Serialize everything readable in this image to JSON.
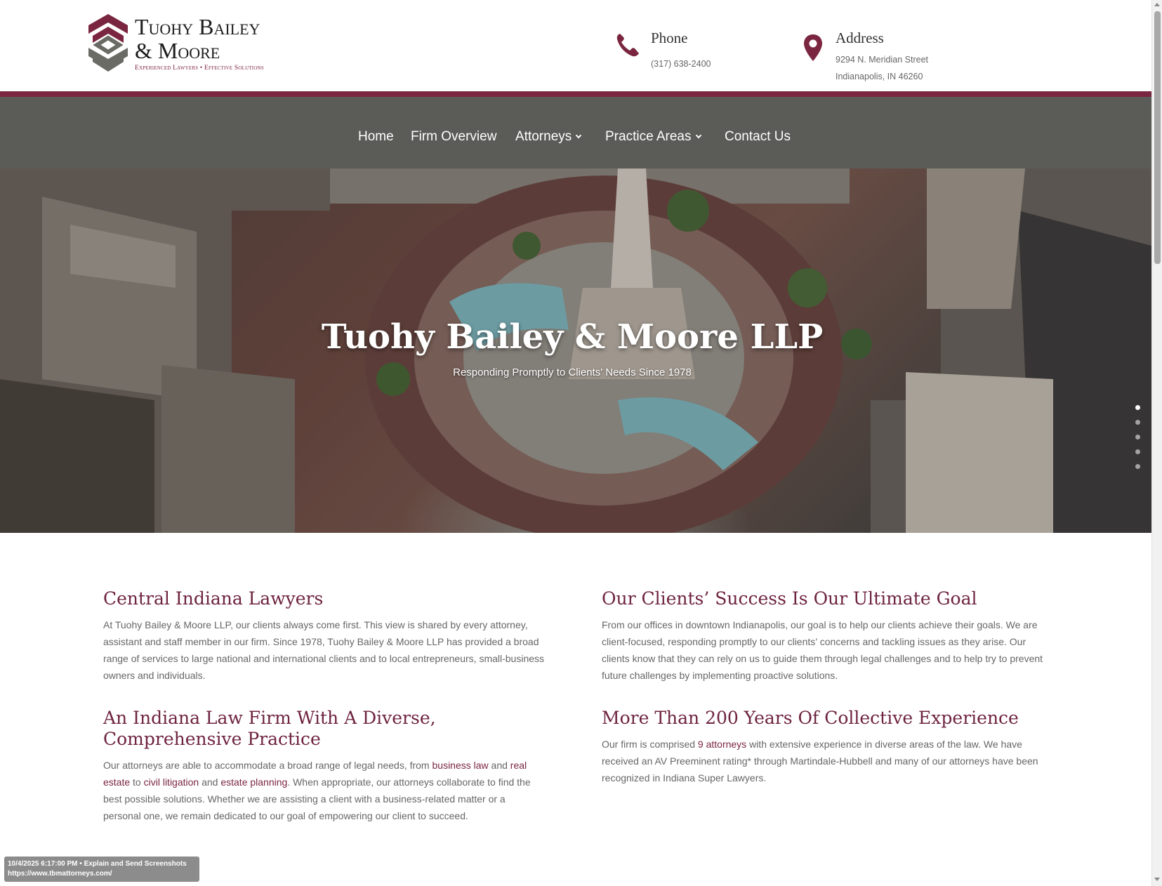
{
  "header": {
    "logo": {
      "line1": "Tuohy Bailey",
      "line2": "& Moore",
      "tagline": "Experienced Lawyers  •  Effective Solutions"
    },
    "phone": {
      "title": "Phone",
      "number": "(317) 638-2400",
      "icon": "phone-icon"
    },
    "address": {
      "title": "Address",
      "line1": "9294 N. Meridian Street",
      "line2": "Indianapolis, IN 46260",
      "icon": "map-pin-icon"
    }
  },
  "nav": {
    "items": [
      {
        "label": "Home"
      },
      {
        "label": "Firm Overview"
      },
      {
        "label": "Attorneys",
        "dropdown": true
      },
      {
        "label": "Practice Areas",
        "dropdown": true
      },
      {
        "label": "Contact Us"
      }
    ]
  },
  "hero": {
    "title": "Tuohy Bailey & Moore LLP",
    "subtitle": "Responding Promptly to Clients' Needs Since 1978",
    "slide_count": 5,
    "active_slide": 1
  },
  "left": {
    "s1": {
      "heading": "Central Indiana Lawyers",
      "text": "At Tuohy Bailey & Moore LLP, our clients always come first. This view is shared by every attorney, assistant and staff member in our firm. Since 1978, Tuohy Bailey & Moore LLP has provided a broad range of services to large national and international clients and to local entrepreneurs, small-business owners and individuals."
    },
    "s2": {
      "heading": "An Indiana Law Firm With A Diverse, Comprehensive Practice",
      "t1": "Our attorneys are able to accommodate a broad range of legal needs, from ",
      "l1": "business law",
      "t2": " and ",
      "l2": "real estate",
      "t3": " to ",
      "l3": "civil litigation",
      "t4": " and ",
      "l4": "estate planning",
      "t5": ".  When appropriate, our attorneys collaborate to find the best possible solutions. Whether we are assisting a client with a business-related matter or a personal one, we remain dedicated to our goal of empowering our client to succeed."
    }
  },
  "right": {
    "s1": {
      "heading": "Our Clients’ Success Is Our Ultimate Goal",
      "text": "From our offices in downtown Indianapolis, our goal is to help our clients achieve their goals. We are client-focused, responding promptly to our clients’ concerns and tackling issues as they arise. Our clients know that they can rely on us to guide them through legal challenges and to help try to prevent future challenges by implementing proactive solutions."
    },
    "s2": {
      "heading": "More Than 200 Years Of Collective Experience",
      "t1": "Our firm is comprised ",
      "l1": "9 attorneys",
      "t2": " with extensive experience in diverse areas of the law. We have received an AV Preeminent rating* through Martindale-Hubbell and many of our attorneys have been recognized in Indiana Super Lawyers."
    }
  },
  "overlay": {
    "line1": "10/4/2025 6:17:00 PM • Explain and Send Screenshots",
    "line2": "https://www.tbmattorneys.com/"
  },
  "colors": {
    "maroon": "#7a2640",
    "nav_bg": "#5b5c58",
    "heading": "#6e2340"
  }
}
